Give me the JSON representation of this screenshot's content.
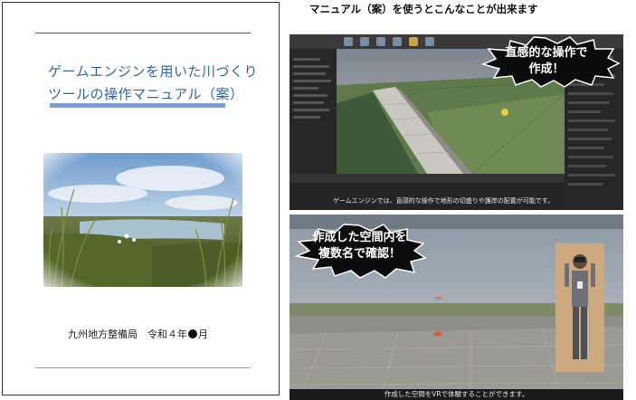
{
  "cover": {
    "title_line1": "ゲームエンジンを用いた川づくり",
    "title_line2": "ツールの操作マニュアル（案）",
    "organization_prefix": "九州地方整備局　令和４年",
    "organization_suffix": "月"
  },
  "heading": "マニュアル（案）を使うとこんなことが出来ます",
  "shot1": {
    "bubble": {
      "line1": "直感的な操作で",
      "line2": "作成！"
    },
    "caption": "ゲームエンジンでは、直感的な操作で地形の切盛りや護岸の配置が可能です。"
  },
  "shot2": {
    "bubble": {
      "line1": "作成した空間内を",
      "line2": "複数名で確認！"
    },
    "caption": "作成した空間をVRで体験することができます。"
  },
  "colors": {
    "cover_title": "#2f66a8",
    "cover_bar": "#7f9bd1",
    "bubble_fill": "#0c0c0c"
  }
}
